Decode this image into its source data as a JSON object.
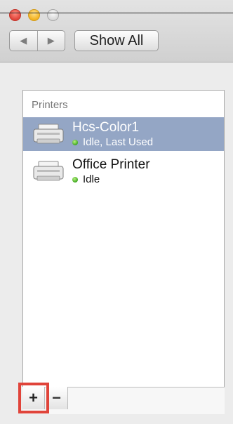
{
  "toolbar": {
    "back_glyph": "◀",
    "forward_glyph": "▶",
    "show_all_label": "Show All"
  },
  "printers": {
    "header": "Printers",
    "items": [
      {
        "name": "Hcs-Color1",
        "status": "Idle, Last Used",
        "selected": true
      },
      {
        "name": "Office Printer",
        "status": "Idle",
        "selected": false
      }
    ]
  },
  "list_controls": {
    "add_label": "+",
    "remove_label": "−"
  },
  "colors": {
    "selection": "#94a6c5",
    "status_idle": "#3ea622",
    "highlight_outline": "#e0443a"
  },
  "icons": [
    "back-arrow-icon",
    "forward-arrow-icon",
    "printer-icon",
    "status-dot-icon"
  ]
}
